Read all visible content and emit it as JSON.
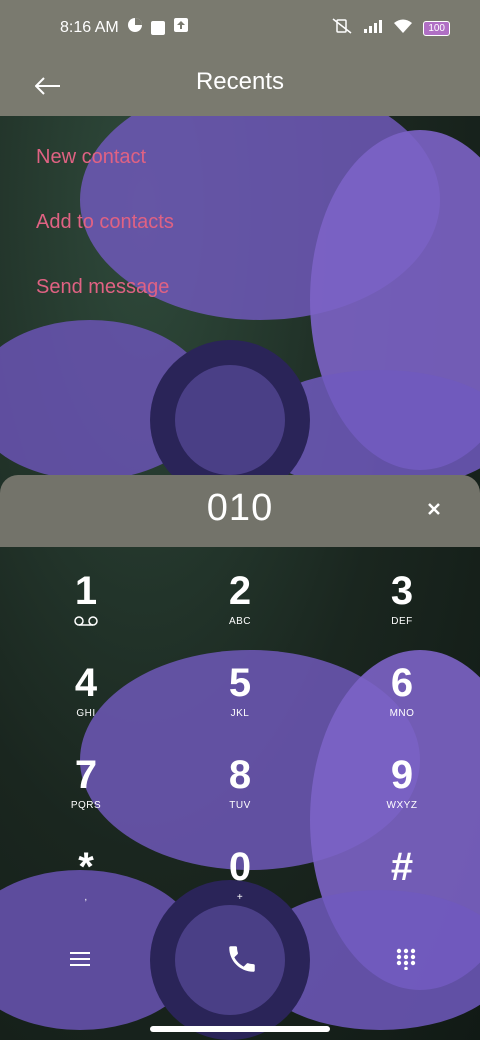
{
  "status": {
    "time": "8:16 AM",
    "battery": "100"
  },
  "header": {
    "title": "Recents"
  },
  "actions": [
    "New contact",
    "Add to contacts",
    "Send message"
  ],
  "dial": {
    "digits": "010"
  },
  "keypad": [
    {
      "num": "1",
      "sub": ""
    },
    {
      "num": "2",
      "sub": "ABC"
    },
    {
      "num": "3",
      "sub": "DEF"
    },
    {
      "num": "4",
      "sub": "GHI"
    },
    {
      "num": "5",
      "sub": "JKL"
    },
    {
      "num": "6",
      "sub": "MNO"
    },
    {
      "num": "7",
      "sub": "PQRS"
    },
    {
      "num": "8",
      "sub": "TUV"
    },
    {
      "num": "9",
      "sub": "WXYZ"
    },
    {
      "num": "*",
      "sub": ","
    },
    {
      "num": "0",
      "sub": "+"
    },
    {
      "num": "#",
      "sub": ""
    }
  ],
  "colors": {
    "accent": "#e06283",
    "bar": "#7a7a6f",
    "dialbar": "#73736a"
  }
}
